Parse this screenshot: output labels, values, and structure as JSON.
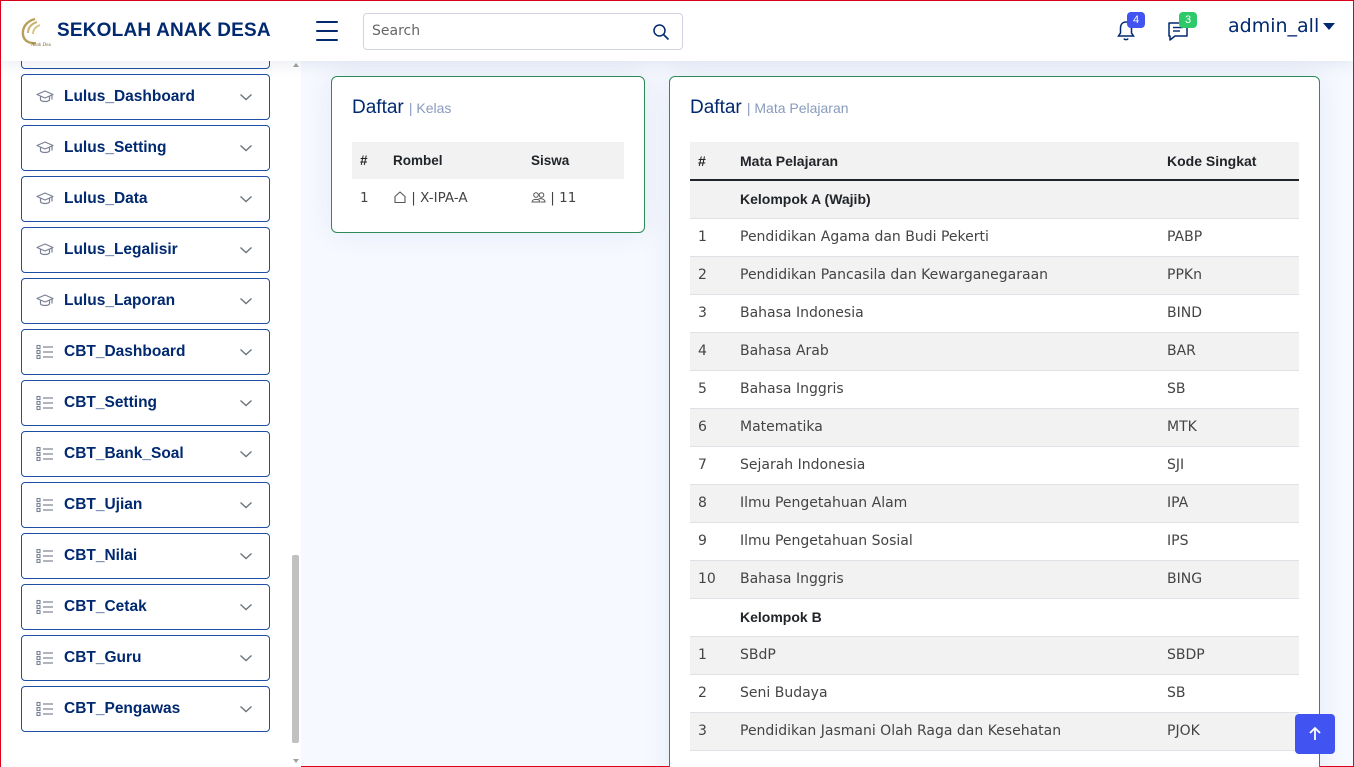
{
  "header": {
    "app_name": "SEKOLAH ANAK DESA",
    "logo_subtext": "Anak Desa",
    "search_placeholder": "Search",
    "notifications_count": "4",
    "messages_count": "3",
    "user_name": "admin_all",
    "colors": {
      "brand": "#012970",
      "notif_badge": "#4154f1",
      "msg_badge": "#2eca6a"
    }
  },
  "sidebar": {
    "items": [
      {
        "label": "Lulus_Dashboard",
        "icon": "mortarboard-icon"
      },
      {
        "label": "Lulus_Setting",
        "icon": "mortarboard-icon"
      },
      {
        "label": "Lulus_Data",
        "icon": "mortarboard-icon"
      },
      {
        "label": "Lulus_Legalisir",
        "icon": "mortarboard-icon"
      },
      {
        "label": "Lulus_Laporan",
        "icon": "mortarboard-icon"
      },
      {
        "label": "CBT_Dashboard",
        "icon": "list-check-icon"
      },
      {
        "label": "CBT_Setting",
        "icon": "list-check-icon"
      },
      {
        "label": "CBT_Bank_Soal",
        "icon": "list-check-icon"
      },
      {
        "label": "CBT_Ujian",
        "icon": "list-check-icon"
      },
      {
        "label": "CBT_Nilai",
        "icon": "list-check-icon"
      },
      {
        "label": "CBT_Cetak",
        "icon": "list-check-icon"
      },
      {
        "label": "CBT_Guru",
        "icon": "list-check-icon"
      },
      {
        "label": "CBT_Pengawas",
        "icon": "list-check-icon"
      }
    ]
  },
  "kelas_card": {
    "title": "Daftar",
    "subtitle": "| Kelas",
    "columns": [
      "#",
      "Rombel",
      "Siswa"
    ],
    "rows": [
      {
        "no": "1",
        "sep": "|",
        "rombel": "X-IPA-A",
        "siswa": "11"
      }
    ]
  },
  "mapel_card": {
    "title": "Daftar",
    "subtitle": "| Mata Pelajaran",
    "columns": [
      "#",
      "Mata Pelajaran",
      "Kode Singkat"
    ],
    "group_a": "Kelompok A (Wajib)",
    "rows_a": [
      {
        "no": "1",
        "name": "Pendidikan Agama dan Budi Pekerti",
        "code": "PABP"
      },
      {
        "no": "2",
        "name": "Pendidikan Pancasila dan Kewarganegaraan",
        "code": "PPKn"
      },
      {
        "no": "3",
        "name": "Bahasa Indonesia",
        "code": "BIND"
      },
      {
        "no": "4",
        "name": "Bahasa Arab",
        "code": "BAR"
      },
      {
        "no": "5",
        "name": "Bahasa Inggris",
        "code": "SB"
      },
      {
        "no": "6",
        "name": "Matematika",
        "code": "MTK"
      },
      {
        "no": "7",
        "name": "Sejarah Indonesia",
        "code": "SJI"
      },
      {
        "no": "8",
        "name": "Ilmu Pengetahuan Alam",
        "code": "IPA"
      },
      {
        "no": "9",
        "name": "Ilmu Pengetahuan Sosial",
        "code": "IPS"
      },
      {
        "no": "10",
        "name": "Bahasa Inggris",
        "code": "BING"
      }
    ],
    "group_b": "Kelompok B",
    "rows_b": [
      {
        "no": "1",
        "name": "SBdP",
        "code": "SBDP"
      },
      {
        "no": "2",
        "name": "Seni Budaya",
        "code": "SB"
      },
      {
        "no": "3",
        "name": "Pendidikan Jasmani Olah Raga dan Kesehatan",
        "code": "PJOK"
      }
    ]
  }
}
